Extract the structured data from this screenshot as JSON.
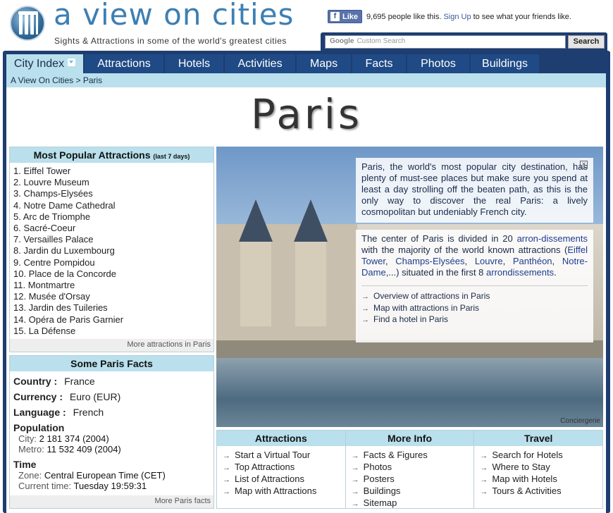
{
  "header": {
    "title": "a view on cities",
    "tagline": "Sights & Attractions in some of the world's greatest cities",
    "fb_like": "Like",
    "fb_text": "9,695 people like this.",
    "fb_signup": "Sign Up",
    "fb_tail": "to see what your friends like.",
    "search_placeholder": "Custom Search",
    "search_logo": "Google",
    "search_button": "Search"
  },
  "nav": {
    "tabs": [
      "City Index",
      "Attractions",
      "Hotels",
      "Activities",
      "Maps",
      "Facts",
      "Photos",
      "Buildings"
    ]
  },
  "breadcrumb": "A View On Cities > Paris",
  "page_title": "Paris",
  "popular": {
    "title": "Most Popular Attractions",
    "subtitle": "(last 7 days)",
    "items": [
      "1. Eiffel Tower",
      "2. Louvre Museum",
      "3. Champs-Elysées",
      "4. Notre Dame Cathedral",
      "5. Arc de Triomphe",
      "6. Sacré-Coeur",
      "7. Versailles Palace",
      "8. Jardin du Luxembourg",
      "9. Centre Pompidou",
      "10. Place de la Concorde",
      "11. Montmartre",
      "12. Musée d'Orsay",
      "13. Jardin des Tuileries",
      "14. Opéra de Paris Garnier",
      "15. La Défense"
    ],
    "more": "More attractions in Paris"
  },
  "facts": {
    "title": "Some Paris Facts",
    "country_label": "Country :",
    "country": "France",
    "currency_label": "Currency :",
    "currency": "Euro (EUR)",
    "language_label": "Language :",
    "language": "French",
    "population_label": "Population",
    "city_label": "City:",
    "city": "2 181 374 (2004)",
    "metro_label": "Metro:",
    "metro": "11 532 409 (2004)",
    "time_label": "Time",
    "zone_label": "Zone:",
    "zone": "Central European Time (CET)",
    "current_label": "Current time:",
    "current": "Tuesday 19:59:31",
    "more": "More Paris facts"
  },
  "photo": {
    "caption": "Conciergerie",
    "intro": "Paris, the world's most popular city destination, has plenty of must-see places but make sure you spend at least a day strolling off the beaten path, as this is the only way to discover the real Paris: a lively cosmopolitan but undeniably French city.",
    "close": "×",
    "center_a": "The center of Paris is divided in 20 ",
    "center_link1": "arron-dissements",
    "center_b": " with the majority of the world known attractions (",
    "link_eiffel": "Eiffel Tower",
    "link_champs": "Champs-Elysées",
    "link_louvre": "Louvre",
    "link_pantheon": "Panthéon",
    "link_notre": "Notre-Dame",
    "center_c": ",...) situated in the first 8 ",
    "center_link2": "arrondissements",
    "center_d": ".",
    "links": [
      "Overview of attractions in Paris",
      "Map with attractions in Paris",
      "Find a hotel in Paris"
    ]
  },
  "bottom": {
    "attractions_title": "Attractions",
    "attractions": [
      "Start a Virtual Tour",
      "Top Attractions",
      "List of Attractions",
      "Map with Attractions"
    ],
    "info_title": "More Info",
    "info": [
      "Facts & Figures",
      "Photos",
      "Posters",
      "Buildings",
      "Sitemap"
    ],
    "travel_title": "Travel",
    "travel": [
      "Search for Hotels",
      "Where to Stay",
      "Map with Hotels",
      "Tours & Activities"
    ]
  }
}
